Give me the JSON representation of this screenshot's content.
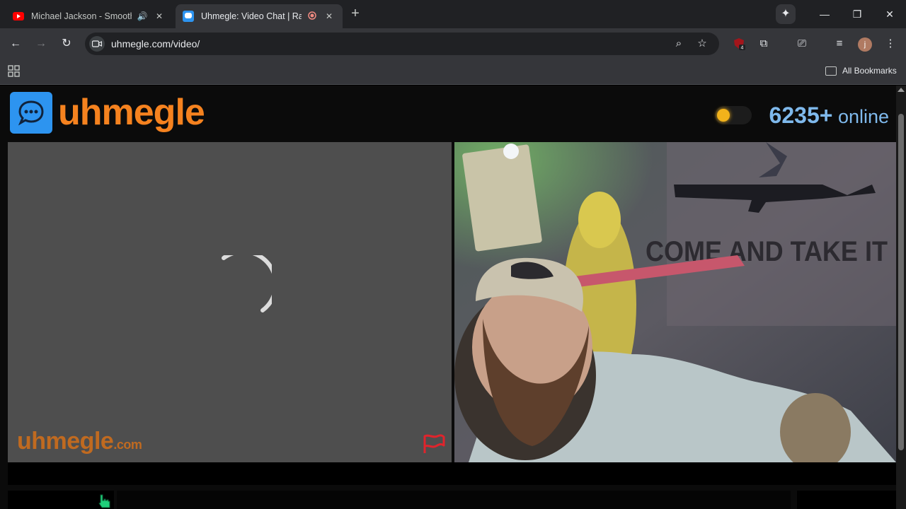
{
  "browser": {
    "tabs": [
      {
        "title": "Michael Jackson - Smooth Criminal",
        "state": "audio"
      },
      {
        "title": "Uhmegle: Video Chat | Random Stranger",
        "state": "active"
      }
    ],
    "url": "uhmegle.com/video/",
    "extension_badge": "4",
    "profile_initial": "j",
    "bookmarks_label": "All Bookmarks"
  },
  "site": {
    "logo_text": "uhmegle",
    "online_count": "6235+",
    "online_label": "online",
    "watermark_main": "uhmegle",
    "watermark_suffix": ".com"
  },
  "colors": {
    "brand_orange": "#f5821f",
    "logo_blue": "#2d94f0",
    "online_blue": "#7fb9ec",
    "report_red": "#e0242c",
    "cursor_green": "#1fd07a"
  },
  "icons": [
    "youtube-icon",
    "audio-icon",
    "close-icon",
    "chat-bubble-icon",
    "recording-icon",
    "plus-icon",
    "sparkle-icon",
    "minimize-icon",
    "restore-icon",
    "back-icon",
    "forward-icon",
    "reload-icon",
    "zoom-icon",
    "star-icon",
    "extensions-icon",
    "apps-icon",
    "folder-icon",
    "flag-icon",
    "hand-cursor-icon"
  ]
}
